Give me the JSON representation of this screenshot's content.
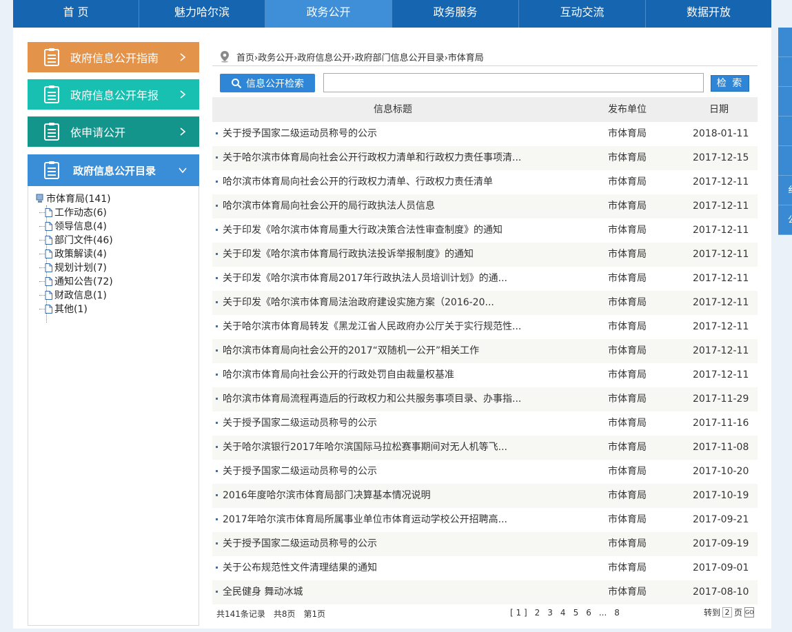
{
  "topnav": {
    "items": [
      {
        "label": "首 页",
        "active": false
      },
      {
        "label": "魅力哈尔滨",
        "active": false
      },
      {
        "label": "政务公开",
        "active": true
      },
      {
        "label": "政务服务",
        "active": false
      },
      {
        "label": "互动交流",
        "active": false
      },
      {
        "label": "数据开放",
        "active": false
      }
    ]
  },
  "right_strip": {
    "items": [
      "",
      "",
      "",
      "",
      "",
      "纟",
      "公"
    ]
  },
  "menu": {
    "guide": "政府信息公开指南",
    "annual": "政府信息公开年报",
    "request": "依申请公开",
    "catalog": "政府信息公开目录"
  },
  "tree": {
    "root": "市体育局(141)",
    "children": [
      "工作动态(6)",
      "领导信息(4)",
      "部门文件(46)",
      "政策解读(4)",
      "规划计划(7)",
      "通知公告(72)",
      "财政信息(1)",
      "其他(1)"
    ]
  },
  "breadcrumb": "首页›政务公开›政府信息公开›政府部门信息公开目录›市体育局",
  "search": {
    "label": "信息公开检索",
    "value": "",
    "button": "检 索"
  },
  "table": {
    "headers": {
      "title": "信息标题",
      "unit": "发布单位",
      "date": "日期"
    },
    "rows": [
      {
        "title": "关于授予国家二级运动员称号的公示",
        "unit": "市体育局",
        "date": "2018-01-11"
      },
      {
        "title": "关于哈尔滨市体育局向社会公开行政权力清单和行政权力责任事项清...",
        "unit": "市体育局",
        "date": "2017-12-15"
      },
      {
        "title": "哈尔滨市体育局向社会公开的行政权力清单、行政权力责任清单",
        "unit": "市体育局",
        "date": "2017-12-11"
      },
      {
        "title": "哈尔滨市体育局向社会公开的局行政执法人员信息",
        "unit": "市体育局",
        "date": "2017-12-11"
      },
      {
        "title": "关于印发《哈尔滨市体育局重大行政决策合法性审查制度》的通知",
        "unit": "市体育局",
        "date": "2017-12-11"
      },
      {
        "title": "关于印发《哈尔滨市体育局行政执法投诉举报制度》的通知",
        "unit": "市体育局",
        "date": "2017-12-11"
      },
      {
        "title": "关于印发《哈尔滨市体育局2017年行政执法人员培训计划》的通...",
        "unit": "市体育局",
        "date": "2017-12-11"
      },
      {
        "title": "关于印发《哈尔滨市体育局法治政府建设实施方案（2016-20...",
        "unit": "市体育局",
        "date": "2017-12-11"
      },
      {
        "title": "关于哈尔滨市体育局转发《黑龙江省人民政府办公厅关于实行规范性...",
        "unit": "市体育局",
        "date": "2017-12-11"
      },
      {
        "title": "哈尔滨市体育局向社会公开的2017“双随机一公开”相关工作",
        "unit": "市体育局",
        "date": "2017-12-11"
      },
      {
        "title": "哈尔滨市体育局向社会公开的行政处罚自由裁量权基准",
        "unit": "市体育局",
        "date": "2017-12-11"
      },
      {
        "title": "哈尔滨市体育局流程再造后的行政权力和公共服务事项目录、办事指...",
        "unit": "市体育局",
        "date": "2017-11-29"
      },
      {
        "title": "关于授予国家二级运动员称号的公示",
        "unit": "市体育局",
        "date": "2017-11-16"
      },
      {
        "title": "关于哈尔滨银行2017年哈尔滨国际马拉松赛事期间对无人机等飞...",
        "unit": "市体育局",
        "date": "2017-11-08"
      },
      {
        "title": "关于授予国家二级运动员称号的公示",
        "unit": "市体育局",
        "date": "2017-10-20"
      },
      {
        "title": "2016年度哈尔滨市体育局部门决算基本情况说明",
        "unit": "市体育局",
        "date": "2017-10-19"
      },
      {
        "title": "2017年哈尔滨市体育局所属事业单位市体育运动学校公开招聘高...",
        "unit": "市体育局",
        "date": "2017-09-21"
      },
      {
        "title": "关于授予国家二级运动员称号的公示",
        "unit": "市体育局",
        "date": "2017-09-19"
      },
      {
        "title": "关于公布规范性文件清理结果的通知",
        "unit": "市体育局",
        "date": "2017-09-01"
      },
      {
        "title": "全民健身 舞动冰城",
        "unit": "市体育局",
        "date": "2017-08-10"
      }
    ]
  },
  "pager": {
    "total": "共141条记录",
    "pages": "共8页",
    "current": "第1页",
    "links": [
      "[ 1 ]",
      "2",
      "3",
      "4",
      "5",
      "6",
      "...",
      "8"
    ],
    "jump_label": "转到",
    "jump_value": "2",
    "page_unit": "页",
    "go": "GO"
  }
}
